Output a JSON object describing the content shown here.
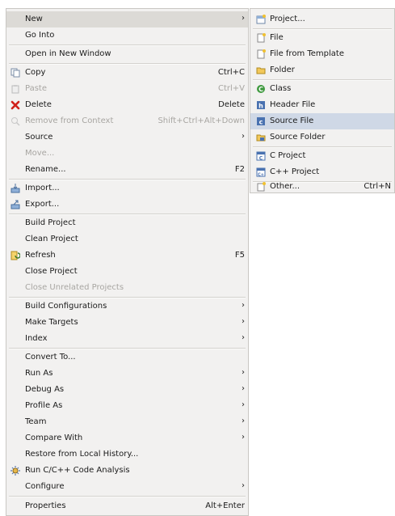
{
  "menu": {
    "new": "New",
    "go_into": "Go Into",
    "open_new_window": "Open in New Window",
    "copy": "Copy",
    "copy_acc": "Ctrl+C",
    "paste": "Paste",
    "paste_acc": "Ctrl+V",
    "delete": "Delete",
    "delete_acc": "Delete",
    "remove_context": "Remove from Context",
    "remove_context_acc": "Shift+Ctrl+Alt+Down",
    "source": "Source",
    "move": "Move...",
    "rename": "Rename...",
    "rename_acc": "F2",
    "import": "Import...",
    "export": "Export...",
    "build_project": "Build Project",
    "clean_project": "Clean Project",
    "refresh": "Refresh",
    "refresh_acc": "F5",
    "close_project": "Close Project",
    "close_unrelated": "Close Unrelated Projects",
    "build_configs": "Build Configurations",
    "make_targets": "Make Targets",
    "index": "Index",
    "convert_to": "Convert To...",
    "run_as": "Run As",
    "debug_as": "Debug As",
    "profile_as": "Profile As",
    "team": "Team",
    "compare_with": "Compare With",
    "restore_history": "Restore from Local History...",
    "run_analysis": "Run C/C++ Code Analysis",
    "configure": "Configure",
    "properties": "Properties",
    "properties_acc": "Alt+Enter"
  },
  "submenu": {
    "project": "Project...",
    "file": "File",
    "file_template": "File from Template",
    "folder": "Folder",
    "class": "Class",
    "header_file": "Header File",
    "source_file": "Source File",
    "source_folder": "Source Folder",
    "c_project": "C Project",
    "cpp_project": "C++ Project",
    "other": "Other...",
    "other_acc": "Ctrl+N"
  },
  "arrow": "›",
  "colors": {
    "highlight": "#dcdad6",
    "selection": "#cfd8e6",
    "disabled": "#a8a6a2",
    "delete_red": "#d0211a"
  }
}
